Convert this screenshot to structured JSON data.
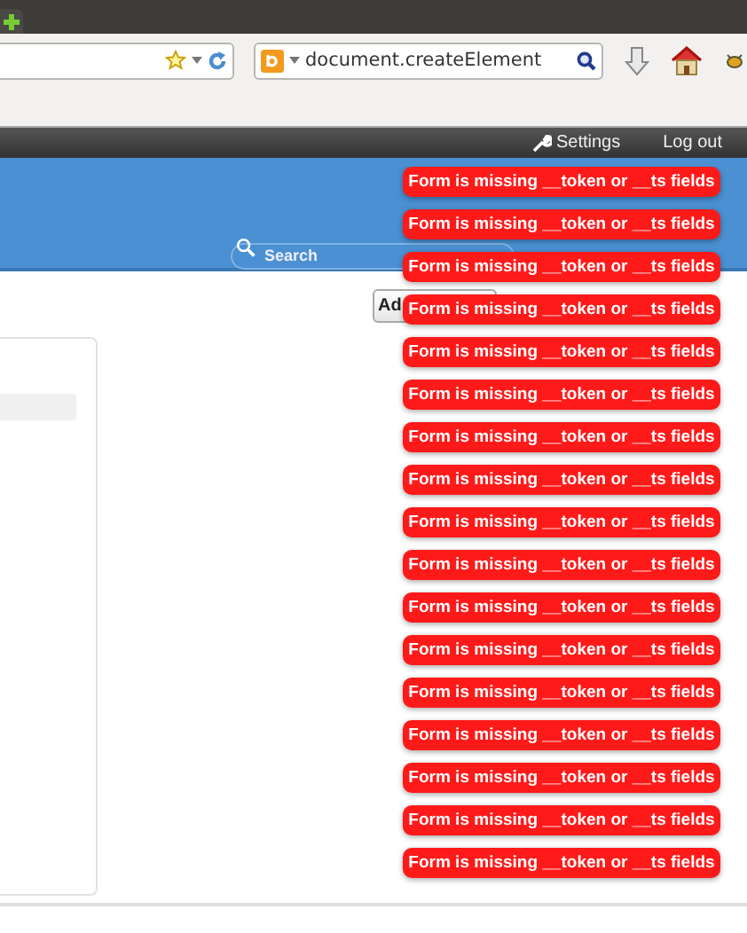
{
  "browser": {
    "search_field": {
      "value": "document.createElement"
    }
  },
  "top_bar": {
    "links": [
      {
        "label": "Settings",
        "kind": "settings"
      },
      {
        "label": "Log out",
        "kind": "plain"
      }
    ]
  },
  "header": {
    "search": {
      "placeholder": "Search"
    }
  },
  "content": {
    "add_button": {
      "label": "Ad"
    }
  },
  "notifications": [
    "Form is missing __token or __ts fields",
    "Form is missing __token or __ts fields",
    "Form is missing __token or __ts fields",
    "Form is missing __token or __ts fields",
    "Form is missing __token or __ts fields",
    "Form is missing __token or __ts fields",
    "Form is missing __token or __ts fields",
    "Form is missing __token or __ts fields",
    "Form is missing __token or __ts fields",
    "Form is missing __token or __ts fields",
    "Form is missing __token or __ts fields",
    "Form is missing __token or __ts fields",
    "Form is missing __token or __ts fields",
    "Form is missing __token or __ts fields",
    "Form is missing __token or __ts fields",
    "Form is missing __token or __ts fields",
    "Form is missing __token or __ts fields"
  ]
}
